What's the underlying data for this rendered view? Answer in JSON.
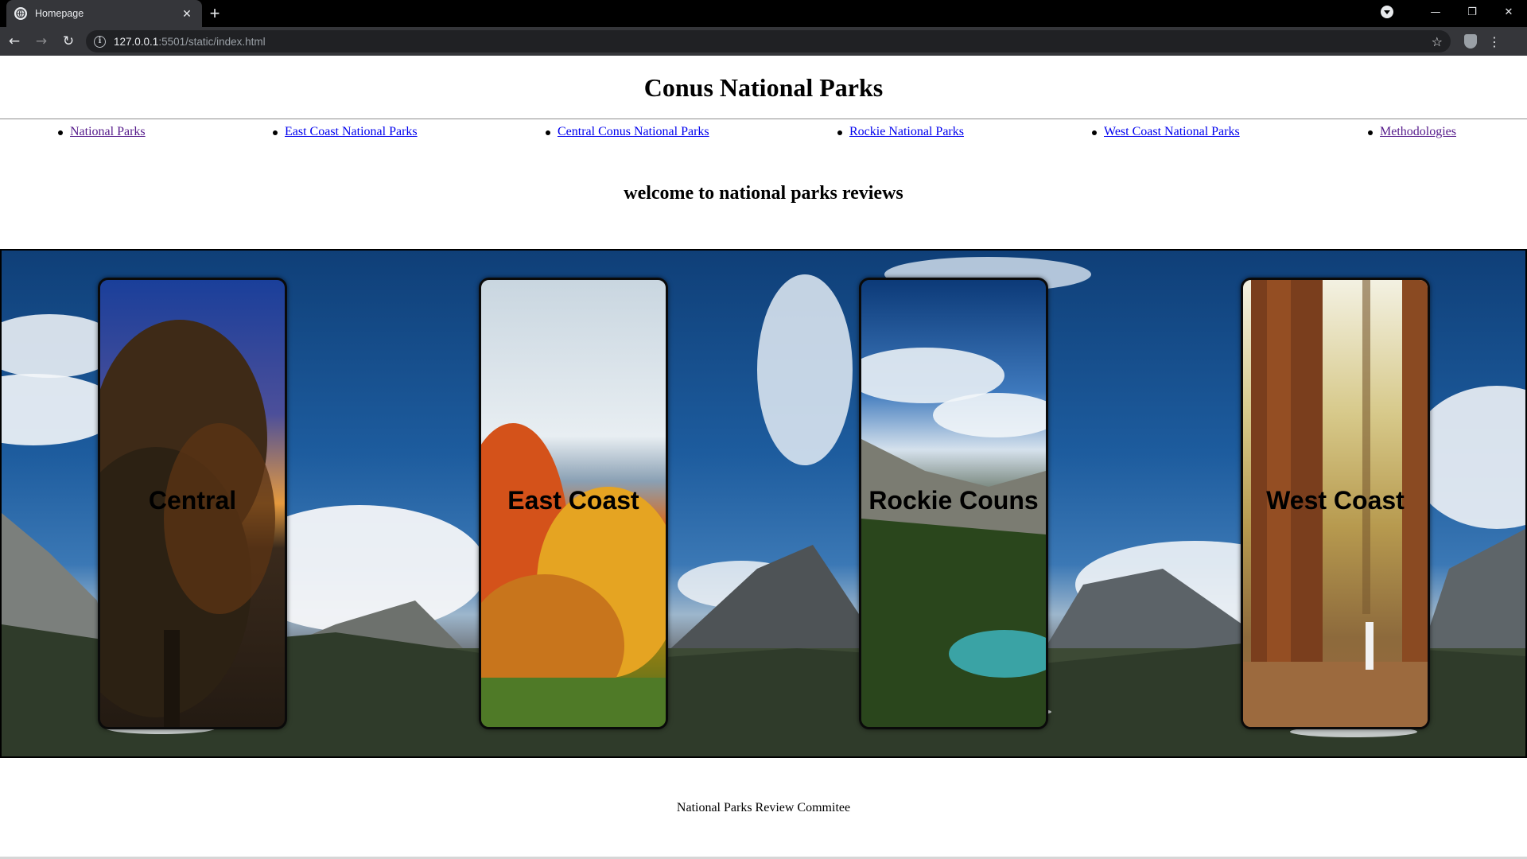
{
  "browser": {
    "tab_title": "Homepage",
    "tab_close": "✕",
    "new_tab": "+",
    "url_host": "127.0.0.1",
    "url_path": ":5501/static/index.html",
    "win_min": "—",
    "win_restore": "❐",
    "win_close": "✕"
  },
  "page": {
    "title": "Conus National Parks",
    "nav": [
      {
        "label": "National Parks"
      },
      {
        "label": "East Coast National Parks"
      },
      {
        "label": "Central Conus National Parks"
      },
      {
        "label": "Rockie National Parks"
      },
      {
        "label": "West Coast National Parks"
      },
      {
        "label": "Methodologies"
      }
    ],
    "welcome": "welcome to national parks reviews",
    "cards": [
      {
        "label": "Central"
      },
      {
        "label": "East Coast"
      },
      {
        "label": "Rockie Couns"
      },
      {
        "label": "West Coast"
      }
    ],
    "footer": "National Parks Review Commitee"
  },
  "colors": {
    "link": "#0000ee",
    "visited_link": "#551a8b",
    "chrome_dark": "#35363a",
    "sky_blue": "#1d5c9e"
  }
}
